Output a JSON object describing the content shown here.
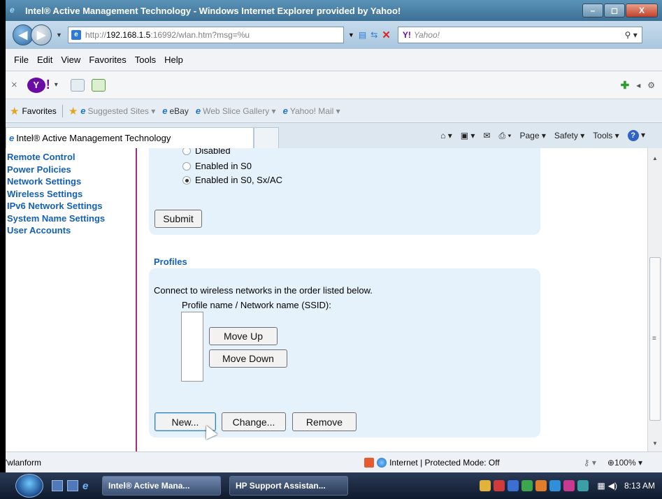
{
  "window": {
    "title": "Intel® Active Management Technology - Windows Internet Explorer provided by Yahoo!",
    "minimize": "–",
    "maximize": "◻",
    "close": "X"
  },
  "address": {
    "url_prefix": "http://",
    "url_host": "192.168.1.5",
    "url_rest": ":16992/wlan.htm?msg=%u",
    "search_brand": "Y!",
    "search_placeholder": "Yahoo!"
  },
  "menu": [
    "File",
    "Edit",
    "View",
    "Favorites",
    "Tools",
    "Help"
  ],
  "favorites_bar": {
    "favorites_label": "Favorites",
    "items": [
      {
        "label": "Suggested Sites ▾",
        "dim": true
      },
      {
        "label": "eBay",
        "dim": false
      },
      {
        "label": "Web Slice Gallery ▾",
        "dim": true
      },
      {
        "label": "Yahoo! Mail ▾",
        "dim": true
      }
    ]
  },
  "tab": {
    "title": "Intel® Active Management Technology"
  },
  "commands": {
    "page": "Page ▾",
    "safety": "Safety ▾",
    "tools": "Tools ▾",
    "help": "?"
  },
  "sidenav": {
    "items": [
      "Remote Control",
      "Power Policies",
      "Network Settings",
      "Wireless Settings",
      "IPv6 Network Settings",
      "System Name Settings",
      "User Accounts"
    ]
  },
  "wireless_power": {
    "options": [
      {
        "label": "Disabled",
        "selected": false
      },
      {
        "label": "Enabled in S0",
        "selected": false
      },
      {
        "label": "Enabled in S0, Sx/AC",
        "selected": true
      }
    ],
    "submit_label": "Submit"
  },
  "profiles": {
    "heading": "Profiles",
    "description": "Connect to wireless networks in the order listed below.",
    "column_header": "Profile name / Network name (SSID):",
    "move_up": "Move Up",
    "move_down": "Move Down",
    "new": "New...",
    "change": "Change...",
    "remove": "Remove"
  },
  "status": {
    "left": "'wlanform",
    "zone": "Internet | Protected Mode: Off",
    "zoom": "100%"
  },
  "taskbar": {
    "tasks": [
      "Intel® Active Mana...",
      "HP Support Assistan..."
    ],
    "clock": "8:13 AM"
  },
  "colors": {
    "link_blue": "#1460b4",
    "panel_bg": "#e5f1fb",
    "nav_divider": "#a0307f"
  }
}
